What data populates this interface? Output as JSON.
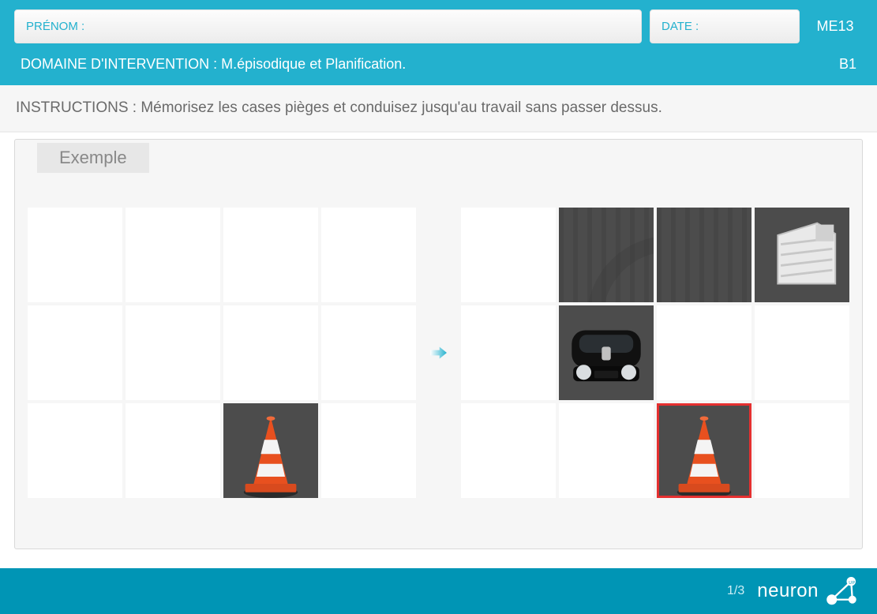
{
  "header": {
    "prenom_label": "PRÉNOM :",
    "date_label": "DATE :",
    "code": "ME13",
    "domain_label": "DOMAINE D'INTERVENTION : M.épisodique et Planification.",
    "level": "B1"
  },
  "instructions": "INSTRUCTIONS : Mémorisez les cases pièges et conduisez jusqu'au travail sans passer dessus.",
  "example_label": "Exemple",
  "grid_left": [
    [
      "",
      "",
      "",
      ""
    ],
    [
      "",
      "",
      "",
      ""
    ],
    [
      "",
      "",
      "cone",
      ""
    ]
  ],
  "grid_right": [
    [
      "",
      "curve",
      "track",
      "building"
    ],
    [
      "",
      "car",
      "",
      ""
    ],
    [
      "",
      "",
      "cone-red",
      ""
    ]
  ],
  "footer": {
    "page": "1/3",
    "brand": "neuron",
    "brand_suffix": "UP"
  }
}
